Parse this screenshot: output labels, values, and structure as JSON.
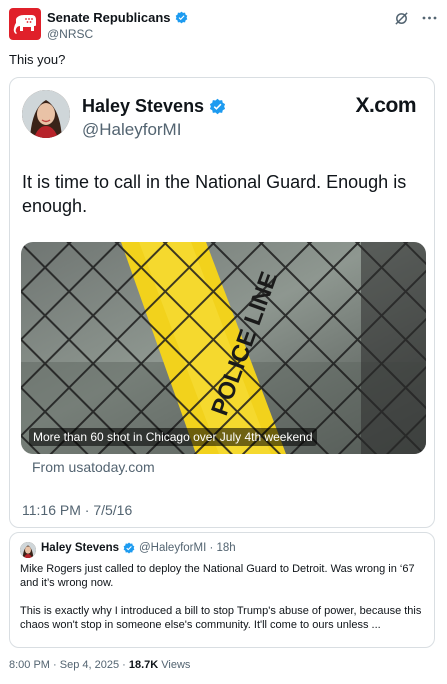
{
  "author": {
    "name": "Senate Republicans",
    "handle": "@NRSC"
  },
  "post": {
    "text": "This you?",
    "timestamp": "8:00 PM · Sep 4, 2025 · ",
    "views_count": "18.7K",
    "views_label": " Views"
  },
  "embedded_screenshot": {
    "name": "Haley Stevens",
    "handle": "@HaleyforMI",
    "site_label": "X.com",
    "text": "It is time to call in the National Guard. Enough is enough.",
    "media_caption": "More than 60 shot in Chicago over July 4th weekend",
    "link_source": "From usatoday.com",
    "timestamp": "11:16 PM · 7/5/16",
    "photo_overlay": "POLICE LINE"
  },
  "quoted_post": {
    "name": "Haley Stevens",
    "handle_time": "@HaleyforMI · 18h",
    "paragraph1": "Mike Rogers just called to deploy the National Guard to Detroit. Was wrong in ‘67 and it’s wrong now.",
    "paragraph2": "This is exactly why I introduced a bill to stop Trump's abuse of power, because this chaos won't stop in someone else's community. It'll come to ours unless ..."
  },
  "colors": {
    "verified": "#1d9bf0",
    "brand_red": "#e0202a",
    "secondary_text": "#536471",
    "tape_yellow": "#f2d21c"
  },
  "icons": [
    "elephant-logo-icon",
    "verified-badge-icon",
    "grok-icon",
    "more-icon"
  ]
}
